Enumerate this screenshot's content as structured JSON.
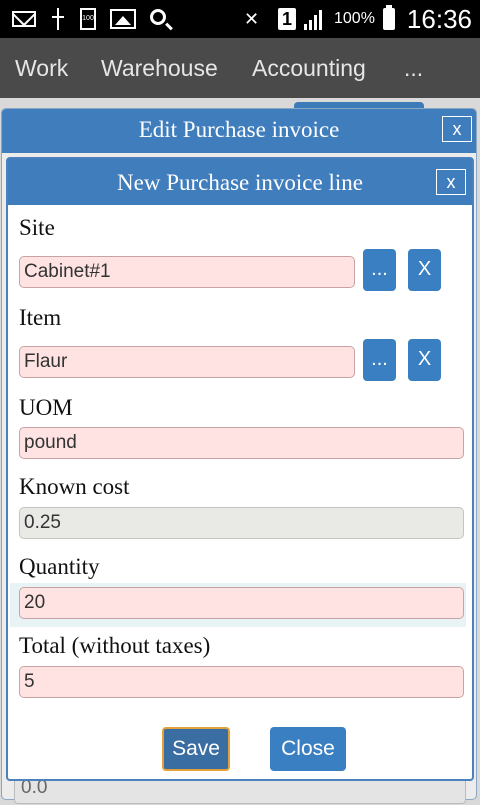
{
  "status_bar": {
    "icons": [
      "mail-icon",
      "usb-icon",
      "battery-100-icon",
      "image-icon",
      "search-icon",
      "mute-icon",
      "sim-icon",
      "signal-icon",
      "battery-icon"
    ],
    "battery_percent": "100%",
    "time": "16:36",
    "sim_number": "1",
    "small_battery_label": "100"
  },
  "menu": {
    "items": [
      "Work",
      "Warehouse",
      "Accounting",
      "..."
    ]
  },
  "background": {
    "partial_value": "0.0"
  },
  "outer_dialog": {
    "title": "Edit Purchase invoice",
    "close_label": "x"
  },
  "dialog": {
    "title": "New Purchase invoice line",
    "close_label": "x",
    "fields": {
      "site": {
        "label": "Site",
        "value": "Cabinet#1",
        "browse_label": "...",
        "clear_label": "X"
      },
      "item": {
        "label": "Item",
        "value": "Flaur",
        "browse_label": "...",
        "clear_label": "X"
      },
      "uom": {
        "label": "UOM",
        "value": "pound"
      },
      "known_cost": {
        "label": "Known cost",
        "value": "0.25"
      },
      "quantity": {
        "label": "Quantity",
        "value": "20"
      },
      "total": {
        "label": "Total (without taxes)",
        "value": "5"
      }
    },
    "save_label": "Save",
    "close_button_label": "Close"
  },
  "colors": {
    "accent": "#3f7dbd",
    "required_field_bg": "#ffe3e3",
    "readonly_field_bg": "#e9e9e6",
    "focus_border": "#e3a13a"
  }
}
